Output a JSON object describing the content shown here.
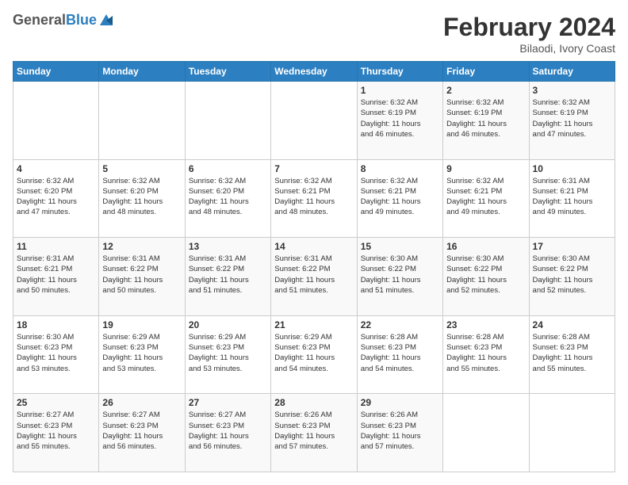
{
  "header": {
    "logo_general": "General",
    "logo_blue": "Blue",
    "month_title": "February 2024",
    "location": "Bilaodi, Ivory Coast"
  },
  "weekdays": [
    "Sunday",
    "Monday",
    "Tuesday",
    "Wednesday",
    "Thursday",
    "Friday",
    "Saturday"
  ],
  "weeks": [
    [
      {
        "day": "",
        "info": ""
      },
      {
        "day": "",
        "info": ""
      },
      {
        "day": "",
        "info": ""
      },
      {
        "day": "",
        "info": ""
      },
      {
        "day": "1",
        "info": "Sunrise: 6:32 AM\nSunset: 6:19 PM\nDaylight: 11 hours\nand 46 minutes."
      },
      {
        "day": "2",
        "info": "Sunrise: 6:32 AM\nSunset: 6:19 PM\nDaylight: 11 hours\nand 46 minutes."
      },
      {
        "day": "3",
        "info": "Sunrise: 6:32 AM\nSunset: 6:19 PM\nDaylight: 11 hours\nand 47 minutes."
      }
    ],
    [
      {
        "day": "4",
        "info": "Sunrise: 6:32 AM\nSunset: 6:20 PM\nDaylight: 11 hours\nand 47 minutes."
      },
      {
        "day": "5",
        "info": "Sunrise: 6:32 AM\nSunset: 6:20 PM\nDaylight: 11 hours\nand 48 minutes."
      },
      {
        "day": "6",
        "info": "Sunrise: 6:32 AM\nSunset: 6:20 PM\nDaylight: 11 hours\nand 48 minutes."
      },
      {
        "day": "7",
        "info": "Sunrise: 6:32 AM\nSunset: 6:21 PM\nDaylight: 11 hours\nand 48 minutes."
      },
      {
        "day": "8",
        "info": "Sunrise: 6:32 AM\nSunset: 6:21 PM\nDaylight: 11 hours\nand 49 minutes."
      },
      {
        "day": "9",
        "info": "Sunrise: 6:32 AM\nSunset: 6:21 PM\nDaylight: 11 hours\nand 49 minutes."
      },
      {
        "day": "10",
        "info": "Sunrise: 6:31 AM\nSunset: 6:21 PM\nDaylight: 11 hours\nand 49 minutes."
      }
    ],
    [
      {
        "day": "11",
        "info": "Sunrise: 6:31 AM\nSunset: 6:21 PM\nDaylight: 11 hours\nand 50 minutes."
      },
      {
        "day": "12",
        "info": "Sunrise: 6:31 AM\nSunset: 6:22 PM\nDaylight: 11 hours\nand 50 minutes."
      },
      {
        "day": "13",
        "info": "Sunrise: 6:31 AM\nSunset: 6:22 PM\nDaylight: 11 hours\nand 51 minutes."
      },
      {
        "day": "14",
        "info": "Sunrise: 6:31 AM\nSunset: 6:22 PM\nDaylight: 11 hours\nand 51 minutes."
      },
      {
        "day": "15",
        "info": "Sunrise: 6:30 AM\nSunset: 6:22 PM\nDaylight: 11 hours\nand 51 minutes."
      },
      {
        "day": "16",
        "info": "Sunrise: 6:30 AM\nSunset: 6:22 PM\nDaylight: 11 hours\nand 52 minutes."
      },
      {
        "day": "17",
        "info": "Sunrise: 6:30 AM\nSunset: 6:22 PM\nDaylight: 11 hours\nand 52 minutes."
      }
    ],
    [
      {
        "day": "18",
        "info": "Sunrise: 6:30 AM\nSunset: 6:23 PM\nDaylight: 11 hours\nand 53 minutes."
      },
      {
        "day": "19",
        "info": "Sunrise: 6:29 AM\nSunset: 6:23 PM\nDaylight: 11 hours\nand 53 minutes."
      },
      {
        "day": "20",
        "info": "Sunrise: 6:29 AM\nSunset: 6:23 PM\nDaylight: 11 hours\nand 53 minutes."
      },
      {
        "day": "21",
        "info": "Sunrise: 6:29 AM\nSunset: 6:23 PM\nDaylight: 11 hours\nand 54 minutes."
      },
      {
        "day": "22",
        "info": "Sunrise: 6:28 AM\nSunset: 6:23 PM\nDaylight: 11 hours\nand 54 minutes."
      },
      {
        "day": "23",
        "info": "Sunrise: 6:28 AM\nSunset: 6:23 PM\nDaylight: 11 hours\nand 55 minutes."
      },
      {
        "day": "24",
        "info": "Sunrise: 6:28 AM\nSunset: 6:23 PM\nDaylight: 11 hours\nand 55 minutes."
      }
    ],
    [
      {
        "day": "25",
        "info": "Sunrise: 6:27 AM\nSunset: 6:23 PM\nDaylight: 11 hours\nand 55 minutes."
      },
      {
        "day": "26",
        "info": "Sunrise: 6:27 AM\nSunset: 6:23 PM\nDaylight: 11 hours\nand 56 minutes."
      },
      {
        "day": "27",
        "info": "Sunrise: 6:27 AM\nSunset: 6:23 PM\nDaylight: 11 hours\nand 56 minutes."
      },
      {
        "day": "28",
        "info": "Sunrise: 6:26 AM\nSunset: 6:23 PM\nDaylight: 11 hours\nand 57 minutes."
      },
      {
        "day": "29",
        "info": "Sunrise: 6:26 AM\nSunset: 6:23 PM\nDaylight: 11 hours\nand 57 minutes."
      },
      {
        "day": "",
        "info": ""
      },
      {
        "day": "",
        "info": ""
      }
    ]
  ]
}
